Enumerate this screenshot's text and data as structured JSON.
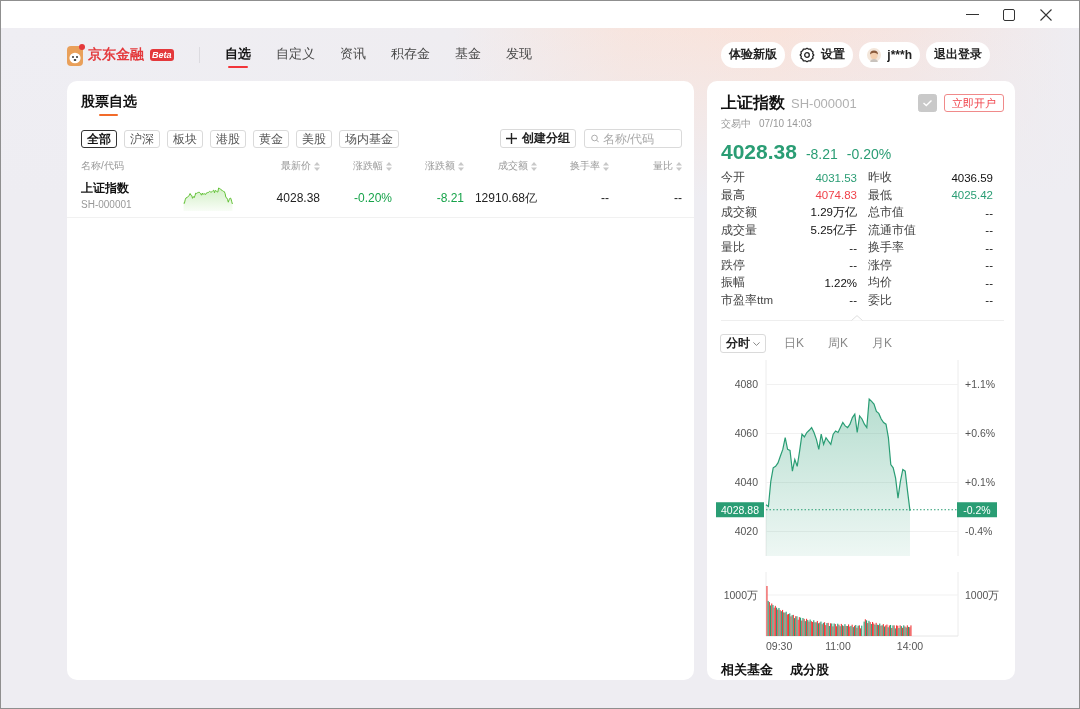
{
  "header": {
    "logo": {
      "text": "京东金融",
      "badge": "Beta"
    },
    "nav": [
      {
        "label": "自选",
        "selected": true
      },
      {
        "label": "自定义",
        "selected": false
      },
      {
        "label": "资讯",
        "selected": false
      },
      {
        "label": "积存金",
        "selected": false
      },
      {
        "label": "基金",
        "selected": false
      },
      {
        "label": "发现",
        "selected": false
      }
    ],
    "actions": [
      {
        "kind": "new_version",
        "label": "体验新版"
      },
      {
        "kind": "settings",
        "label": "设置"
      },
      {
        "kind": "user",
        "label": "j***h"
      },
      {
        "kind": "logout",
        "label": "退出登录"
      }
    ]
  },
  "watchlist": {
    "title": "股票自选",
    "filters": [
      {
        "label": "全部",
        "selected": true
      },
      {
        "label": "沪深",
        "selected": false
      },
      {
        "label": "板块",
        "selected": false
      },
      {
        "label": "港股",
        "selected": false
      },
      {
        "label": "黄金",
        "selected": false
      },
      {
        "label": "美股",
        "selected": false
      },
      {
        "label": "场内基金",
        "selected": false
      }
    ],
    "create_group": "创建分组",
    "search": {
      "placeholder": "名称/代码"
    },
    "table": {
      "columns": [
        {
          "label": "名称/代码",
          "sortable": false
        },
        {
          "label": "最新价",
          "sortable": true
        },
        {
          "label": "涨跌幅",
          "sortable": true
        },
        {
          "label": "涨跌额",
          "sortable": true
        },
        {
          "label": "成交额",
          "sortable": true
        },
        {
          "label": "换手率",
          "sortable": true
        },
        {
          "label": "量比",
          "sortable": true
        }
      ],
      "rows": [
        {
          "cells": [
            {
              "name": "上证指数",
              "code": "SH-000001"
            },
            {
              "text": "4028.38"
            },
            {
              "text": "-0.20%",
              "color": "#17a34a"
            },
            {
              "text": "-8.21",
              "color": "#17a34a"
            },
            {
              "text": "12910.68亿"
            },
            {
              "text": "--"
            },
            {
              "text": "--"
            }
          ]
        }
      ]
    }
  },
  "quote": {
    "name": "上证指数",
    "code": "SH-000001",
    "in_watchlist": true,
    "open_account": "立即开户",
    "status": "交易中",
    "time": "07/10 14:03",
    "price": "4028.38",
    "change": "-8.21",
    "change_pct": "-0.20%",
    "color": "#2a9d74",
    "stats": {
      "rows": [
        {
          "cells": [
            {
              "text": "今开"
            },
            {
              "text": "4031.53",
              "color": "#2a9d74"
            },
            {
              "text": "昨收"
            },
            {
              "text": "4036.59"
            }
          ]
        },
        {
          "cells": [
            {
              "text": "最高"
            },
            {
              "text": "4074.83",
              "color": "#f0424a"
            },
            {
              "text": "最低"
            },
            {
              "text": "4025.42",
              "color": "#2a9d74"
            }
          ]
        },
        {
          "cells": [
            {
              "text": "成交额"
            },
            {
              "text": "1.29万亿"
            },
            {
              "text": "总市值"
            },
            {
              "text": "--"
            }
          ]
        },
        {
          "cells": [
            {
              "text": "成交量"
            },
            {
              "text": "5.25亿手"
            },
            {
              "text": "流通市值"
            },
            {
              "text": "--"
            }
          ]
        },
        {
          "cells": [
            {
              "text": "量比"
            },
            {
              "text": "--"
            },
            {
              "text": "换手率"
            },
            {
              "text": "--"
            }
          ]
        },
        {
          "cells": [
            {
              "text": "跌停"
            },
            {
              "text": "--"
            },
            {
              "text": "涨停"
            },
            {
              "text": "--"
            }
          ]
        },
        {
          "cells": [
            {
              "text": "振幅"
            },
            {
              "text": "1.22%"
            },
            {
              "text": "均价"
            },
            {
              "text": "--"
            }
          ]
        },
        {
          "cells": [
            {
              "text": "市盈率ttm"
            },
            {
              "text": "--"
            },
            {
              "text": "委比"
            },
            {
              "text": "--"
            }
          ]
        }
      ]
    },
    "chart_tabs": [
      {
        "label": "分时",
        "selected": true,
        "has_menu": true
      },
      {
        "label": "日K",
        "selected": false,
        "has_menu": false
      },
      {
        "label": "周K",
        "selected": false,
        "has_menu": false
      },
      {
        "label": "月K",
        "selected": false,
        "has_menu": false
      }
    ],
    "chart": {
      "chart_data": {
        "type": "area",
        "series": [
          {
            "color": "#2a9d74",
            "values": [
              4030.9,
              4030.2,
              4040.5,
              4046.0,
              4046.6,
              4048.0,
              4050.8,
              4053.5,
              4058.3,
              4053.5,
              4053.1,
              4044.6,
              4049.4,
              4046.6,
              4052.8,
              4059.7,
              4058.6,
              4060.4,
              4061.3,
              4062.4,
              4060.4,
              4057.6,
              4053.5,
              4059.7,
              4055.6,
              4058.3,
              4056.9,
              4055.6,
              4059.7,
              4061.0,
              4060.4,
              4062.4,
              4064.5,
              4063.1,
              4062.4,
              4063.8,
              4066.5,
              4067.9,
              4060.4,
              4067.2,
              4065.9,
              4063.8,
              4062.4,
              4074.1,
              4073.1,
              4072.0,
              4069.0,
              4068.2,
              4065.9,
              4064.5,
              4063.8,
              4058.3,
              4047.3,
              4046.0,
              4041.8,
              4033.6,
              4040.5,
              4045.3,
              4044.6,
              4036.3,
              4028.4,
              null,
              null,
              null,
              null,
              null,
              null,
              null,
              null,
              null,
              null,
              null,
              null,
              null,
              null,
              null,
              null,
              null,
              null,
              null,
              null
            ]
          }
        ],
        "ylim": [
          4010,
          4090
        ],
        "yticks": [
          4080,
          4060,
          4040,
          4020
        ],
        "grid": true,
        "ref_lines": [
          {
            "axis": "y",
            "value": 4028.88,
            "label": "4028.88"
          }
        ]
      },
      "right_axis_labels": [
        "+1.1%",
        "+0.6%",
        "+0.1%",
        "-0.4%"
      ],
      "ref_line_percent": "-0.2%",
      "volume_labels": [
        "1000万",
        "1000万"
      ],
      "time_labels": [
        "09:30",
        "11:00",
        "14:00"
      ]
    },
    "bottom_tabs": [
      "相关基金",
      "成分股"
    ]
  }
}
